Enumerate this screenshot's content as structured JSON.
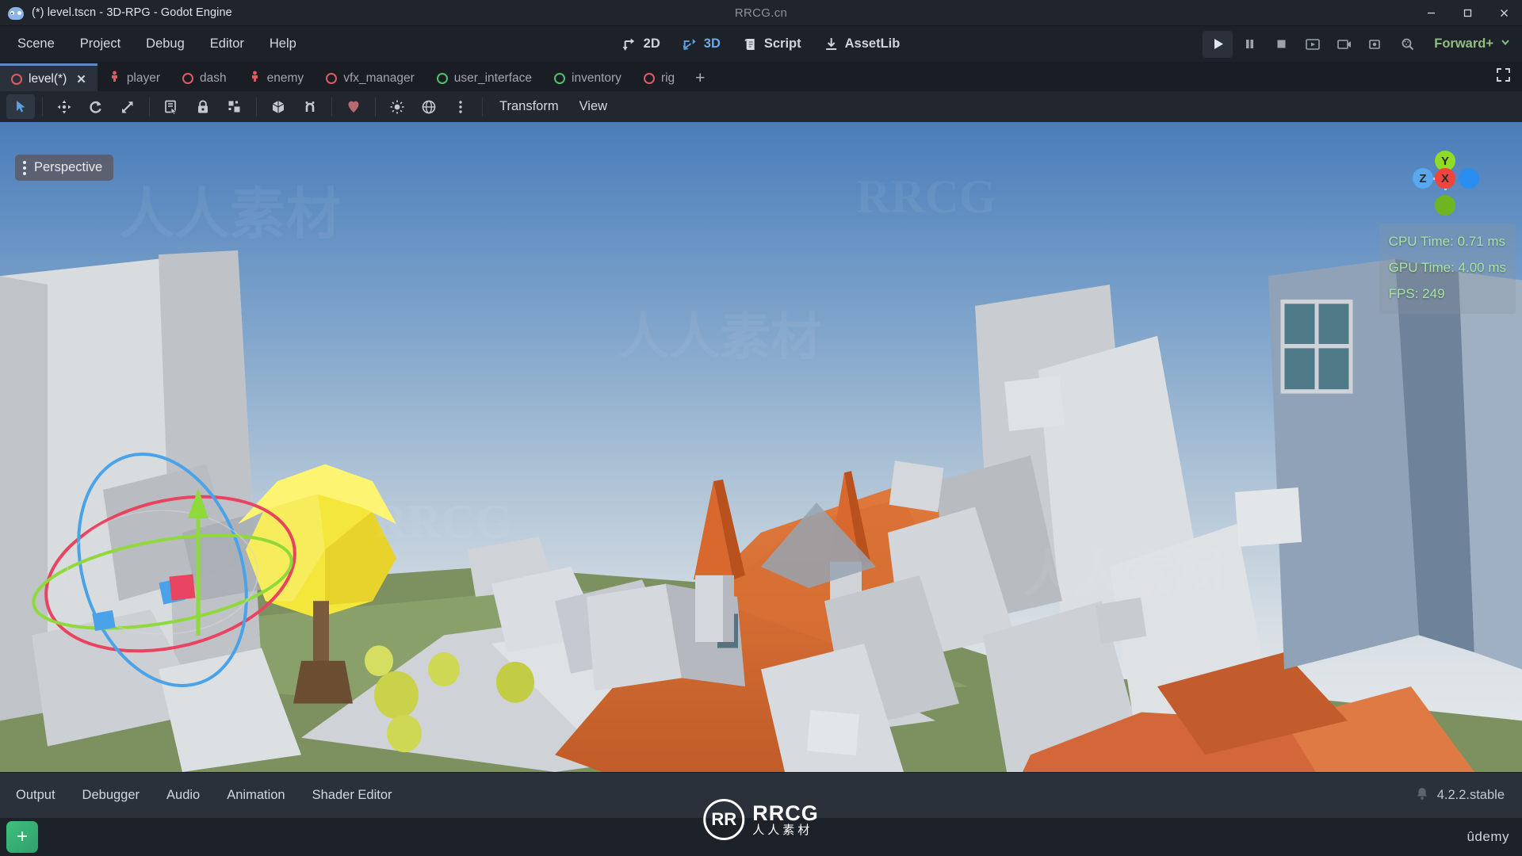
{
  "window": {
    "title": "(*) level.tscn - 3D-RPG - Godot Engine",
    "watermark": "RRCG.cn",
    "icon": "godot-robot-icon",
    "minimize": "minimize-icon",
    "maximize": "maximize-icon",
    "close": "close-icon"
  },
  "menu": {
    "items": [
      "Scene",
      "Project",
      "Debug",
      "Editor",
      "Help"
    ]
  },
  "mode_switch": {
    "items": [
      {
        "label": "2D",
        "icon": "2d-icon",
        "active": false
      },
      {
        "label": "3D",
        "icon": "3d-icon",
        "active": true
      },
      {
        "label": "Script",
        "icon": "script-icon",
        "active": false
      },
      {
        "label": "AssetLib",
        "icon": "assetlib-download-icon",
        "active": false
      }
    ]
  },
  "run_bar": {
    "buttons": [
      "play-icon",
      "pause-icon",
      "stop-icon",
      "play-current-scene-icon",
      "movie-maker-icon",
      "remote-debug-icon",
      "search-icon"
    ],
    "renderer": "Forward+",
    "renderer_chevron": "chevron-down-icon",
    "renderer_color": "#8fbf7e"
  },
  "scene_tabs": {
    "tabs": [
      {
        "label": "level(*)",
        "icon": "node3d-ring-icon",
        "color": "#e05a63",
        "active": true,
        "closable": true
      },
      {
        "label": "player",
        "icon": "character-icon",
        "color": "#e05a63",
        "active": false,
        "closable": false
      },
      {
        "label": "dash",
        "icon": "node3d-ring-icon",
        "color": "#e05a63",
        "active": false,
        "closable": false
      },
      {
        "label": "enemy",
        "icon": "character-icon",
        "color": "#e05a63",
        "active": false,
        "closable": false
      },
      {
        "label": "vfx_manager",
        "icon": "node3d-ring-icon",
        "color": "#e05a63",
        "active": false,
        "closable": false
      },
      {
        "label": "user_interface",
        "icon": "control-ring-icon",
        "color": "#4fc16b",
        "active": false,
        "closable": false
      },
      {
        "label": "inventory",
        "icon": "control-ring-icon",
        "color": "#4fc16b",
        "active": false,
        "closable": false
      },
      {
        "label": "rig",
        "icon": "node3d-ring-icon",
        "color": "#e05a63",
        "active": false,
        "closable": false
      }
    ],
    "add_label": "+",
    "expand_icon": "expand-viewport-icon"
  },
  "viewport_toolbar": {
    "tools": [
      {
        "name": "select-mode-tool",
        "icon": "cursor-arrow-icon",
        "selected": true
      },
      {
        "name": "move-mode-tool",
        "icon": "move-arrows-icon",
        "selected": false
      },
      {
        "name": "rotate-mode-tool",
        "icon": "rotate-icon",
        "selected": false
      },
      {
        "name": "scale-mode-tool",
        "icon": "scale-icon",
        "selected": false
      },
      {
        "name": "list-select-tool",
        "icon": "list-select-icon",
        "selected": false
      },
      {
        "name": "lock-tool",
        "icon": "lock-icon",
        "selected": false
      },
      {
        "name": "group-tool",
        "icon": "group-nodes-icon",
        "selected": false
      },
      {
        "name": "local-space-tool",
        "icon": "cube-icon",
        "selected": false
      },
      {
        "name": "snap-tool",
        "icon": "magnet-snap-icon",
        "selected": false
      },
      {
        "name": "gizmo-visibility-tool",
        "icon": "gizmo-blob-icon",
        "selected": false
      },
      {
        "name": "preview-sun-tool",
        "icon": "sun-icon",
        "selected": false
      },
      {
        "name": "preview-environment-tool",
        "icon": "globe-icon",
        "selected": false
      },
      {
        "name": "more-options-tool",
        "icon": "kebab-menu-icon",
        "selected": false
      }
    ],
    "menus": [
      "Transform",
      "View"
    ]
  },
  "viewport": {
    "perspective_label": "Perspective",
    "perspective_menu_icon": "kebab-menu-icon",
    "stats": [
      "CPU Time: 0.71 ms",
      "GPU Time: 4.00 ms",
      "FPS: 249"
    ],
    "stats_color": "#a6e6a0",
    "axis_gizmo": {
      "x": "X",
      "y": "Y",
      "z": "Z",
      "x_color": "#f0443c",
      "y_color": "#8fdb26",
      "z_color": "#2a8df0"
    }
  },
  "bottom_dock": {
    "tabs": [
      "Output",
      "Debugger",
      "Audio",
      "Animation",
      "Shader Editor"
    ],
    "version": "4.2.2.stable",
    "bell_icon": "notification-bell-icon"
  },
  "overlay_logo": {
    "mark": "RR",
    "name": "RRCG",
    "subtitle": "人人素材"
  },
  "taskbar": {
    "app_icon": "add-app-icon",
    "brand": "ûdemy"
  },
  "watermarks": [
    "RRCG",
    "人人素材",
    "RRCG.cn"
  ]
}
